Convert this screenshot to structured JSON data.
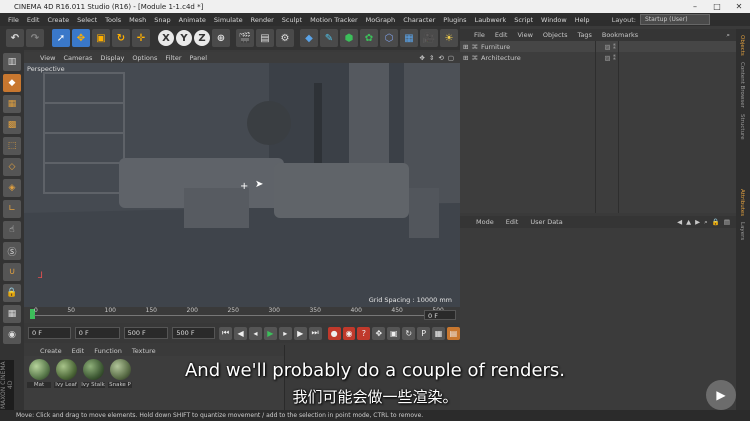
{
  "window": {
    "title": "CINEMA 4D R16.011 Studio (R16) - [Module 1-1.c4d *]"
  },
  "menubar": {
    "items": [
      "File",
      "Edit",
      "Create",
      "Select",
      "Tools",
      "Mesh",
      "Snap",
      "Animate",
      "Simulate",
      "Render",
      "Sculpt",
      "Motion Tracker",
      "MoGraph",
      "Character",
      "Plugins",
      "Laubwerk",
      "Script",
      "Window",
      "Help"
    ],
    "layout_label": "Layout:",
    "layout_value": "Startup (User)"
  },
  "toolbar": {
    "axis_x": "X",
    "axis_y": "Y",
    "axis_z": "Z"
  },
  "viewport": {
    "menu": [
      "View",
      "Cameras",
      "Display",
      "Options",
      "Filter",
      "Panel"
    ],
    "label": "Perspective",
    "grid_spacing": "Grid Spacing : 10000 mm"
  },
  "timeline": {
    "ticks": [
      "0",
      "50",
      "100",
      "150",
      "200",
      "250",
      "300",
      "350",
      "400",
      "450",
      "500"
    ],
    "frame_end": "0 F"
  },
  "transport": {
    "start_field": "0 F",
    "current_field": "0 F",
    "end_field": "500 F",
    "end2_field": "500 F"
  },
  "material_manager": {
    "menu": [
      "Create",
      "Edit",
      "Function",
      "Texture"
    ],
    "materials": [
      {
        "name": "Mat",
        "color": "#5a7a4c"
      },
      {
        "name": "Ivy Leaf",
        "color": "#4f6a3a"
      },
      {
        "name": "Ivy Stalk",
        "color": "#3f5a35"
      },
      {
        "name": "Snake P",
        "color": "#5b6e48"
      }
    ]
  },
  "object_manager": {
    "menu": [
      "File",
      "Edit",
      "View",
      "Objects",
      "Tags",
      "Bookmarks"
    ],
    "objects": [
      "Furniture",
      "Architecture"
    ]
  },
  "attribute_manager": {
    "menu": [
      "Mode",
      "Edit",
      "User Data"
    ]
  },
  "right_tabs": [
    "Objects",
    "Content Browser",
    "Structure",
    "Attributes",
    "Layers"
  ],
  "status_bar": "Move: Click and drag to move elements. Hold down SHIFT to quantize movement / add to the selection in point mode, CTRL to remove.",
  "subtitles": {
    "en": "And we'll probably do a couple of renders.",
    "zh": "我们可能会做一些渲染。"
  },
  "brand": "MAXON CINEMA 4D",
  "colors": {
    "accent_blue": "#3a78c9",
    "record_red": "#c0392b",
    "play_green": "#2ea34a"
  }
}
